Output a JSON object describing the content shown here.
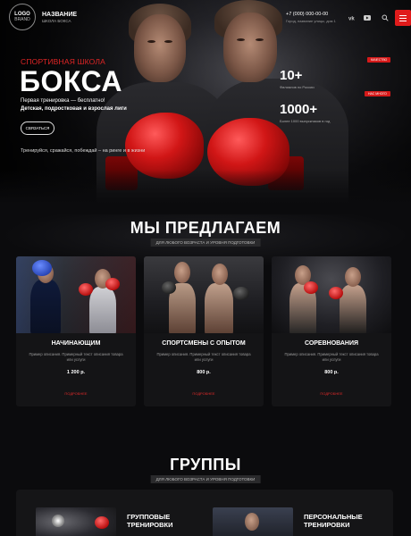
{
  "header": {
    "logo_line1": "LOGO",
    "logo_line2": "BRAND",
    "brand_name": "НАЗВАНИЕ",
    "brand_sub": "ШКОЛА БОКСА",
    "phone": "+7 (000) 000-00-00",
    "address": "Город, название улицы, дом 1",
    "icons": [
      "vk-icon",
      "youtube-icon",
      "search-icon",
      "menu-icon"
    ]
  },
  "hero": {
    "subtitle": "СПОРТИВНАЯ ШКОЛА",
    "title": "БОКСА",
    "line1": "Первая тренировка — бесплатно!",
    "line2": "Детская, подростковая и взрослая лиги",
    "cta": "СВЯЗАТЬСЯ",
    "motto": "Тренируйся, сражайся, побеждай – на ринге и в жизни",
    "stats": [
      {
        "num": "10+",
        "label": "Филиалов по России",
        "tag": "КАЧЕСТВО"
      },
      {
        "num": "1000+",
        "label": "Более 1000 выпускников в год",
        "tag": "НАС МНОГО"
      }
    ]
  },
  "offer": {
    "title": "МЫ ПРЕДЛАГАЕМ",
    "badge": "ДЛЯ ЛЮБОГО ВОЗРАСТА И УРОВНЯ ПОДГОТОВКИ",
    "cards": [
      {
        "title": "НАЧИНАЮЩИМ",
        "desc": "Пример описания. Примерный текст описания товара или услуги",
        "price": "1 200 р.",
        "more": "ПОДРОБНЕЕ"
      },
      {
        "title": "СПОРТСМЕНЫ С ОПЫТОМ",
        "desc": "Пример описания. Примерный текст описания товара или услуги",
        "price": "800 р.",
        "more": "ПОДРОБНЕЕ"
      },
      {
        "title": "СОРЕВНОВАНИЯ",
        "desc": "Пример описания. Примерный текст описания товара или услуги",
        "price": "800 р.",
        "more": "ПОДРОБНЕЕ"
      }
    ]
  },
  "groups": {
    "title": "ГРУППЫ",
    "badge": "ДЛЯ ЛЮБОГО ВОЗРАСТА И УРОВНЯ ПОДГОТОВКИ",
    "items": [
      {
        "line1": "ГРУППОВЫЕ",
        "line2": "ТРЕНИРОВКИ"
      },
      {
        "line1": "ПЕРСОНАЛЬНЫЕ",
        "line2": "ТРЕНИРОВКИ"
      }
    ]
  },
  "colors": {
    "accent": "#e01b1b",
    "background": "#0b0b0d",
    "card": "#141416"
  }
}
